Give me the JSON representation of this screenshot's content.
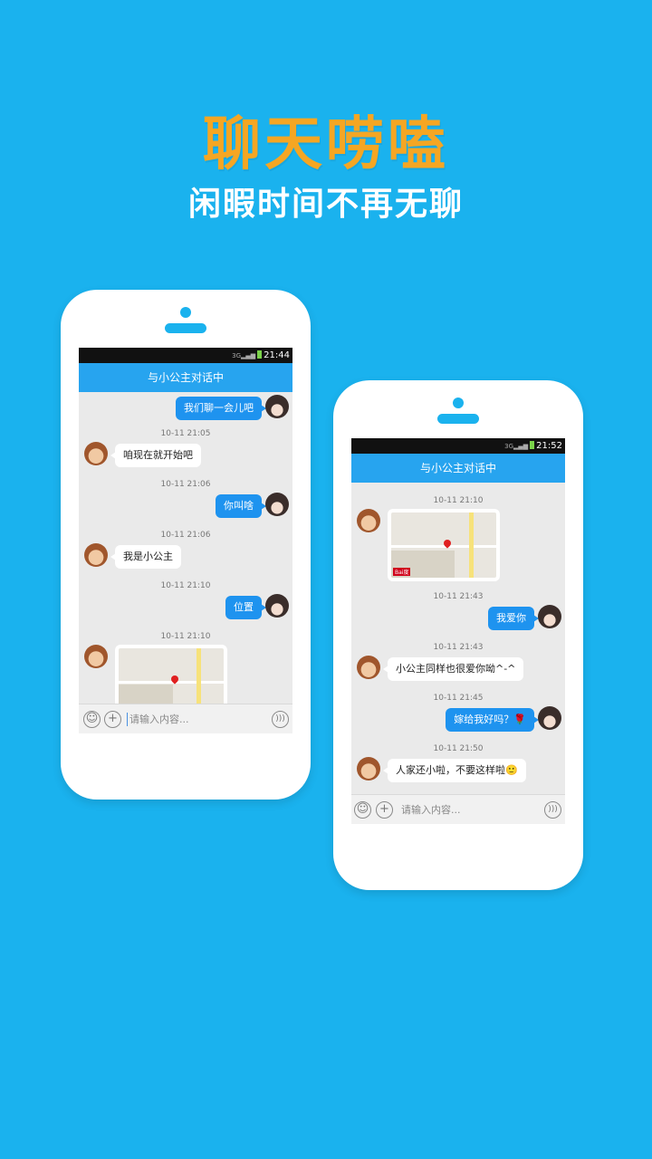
{
  "hero": {
    "title": "聊天唠嗑",
    "subtitle": "闲暇时间不再无聊"
  },
  "colors": {
    "background": "#1ab2ee",
    "title": "#f5a623",
    "titlebar": "#27a4ef",
    "sent_bubble": "#1e93ef"
  },
  "phone1": {
    "status_time": "21:44",
    "chat_title": "与小公主对话中",
    "messages": [
      {
        "side": "right",
        "text": "我们聊一会儿吧"
      },
      {
        "timestamp": "10-11 21:05",
        "side": "left",
        "text": "咱现在就开始吧"
      },
      {
        "timestamp": "10-11 21:06",
        "side": "right",
        "text": "你叫啥"
      },
      {
        "timestamp": "10-11 21:06",
        "side": "left",
        "text": "我是小公主"
      },
      {
        "timestamp": "10-11 21:10",
        "side": "right",
        "text": "位置"
      },
      {
        "timestamp": "10-11 21:10",
        "side": "left",
        "type": "map"
      }
    ],
    "input_placeholder": "请输入内容..."
  },
  "phone2": {
    "status_time": "21:52",
    "chat_title": "与小公主对话中",
    "messages": [
      {
        "timestamp": "10-11 21:10",
        "side": "left",
        "type": "map"
      },
      {
        "timestamp": "10-11 21:43",
        "side": "right",
        "text": "我爱你"
      },
      {
        "timestamp": "10-11 21:43",
        "side": "left",
        "text": "小公主同样也很爱你呦^-^"
      },
      {
        "timestamp": "10-11 21:45",
        "side": "right",
        "text": "嫁给我好吗？🌹"
      },
      {
        "timestamp": "10-11 21:50",
        "side": "left",
        "text": "人家还小啦，不要这样啦🙂"
      }
    ],
    "input_placeholder": "请输入内容..."
  },
  "icons": {
    "emoji": "smiley-icon",
    "add": "plus-icon",
    "voice": "voice-icon"
  }
}
